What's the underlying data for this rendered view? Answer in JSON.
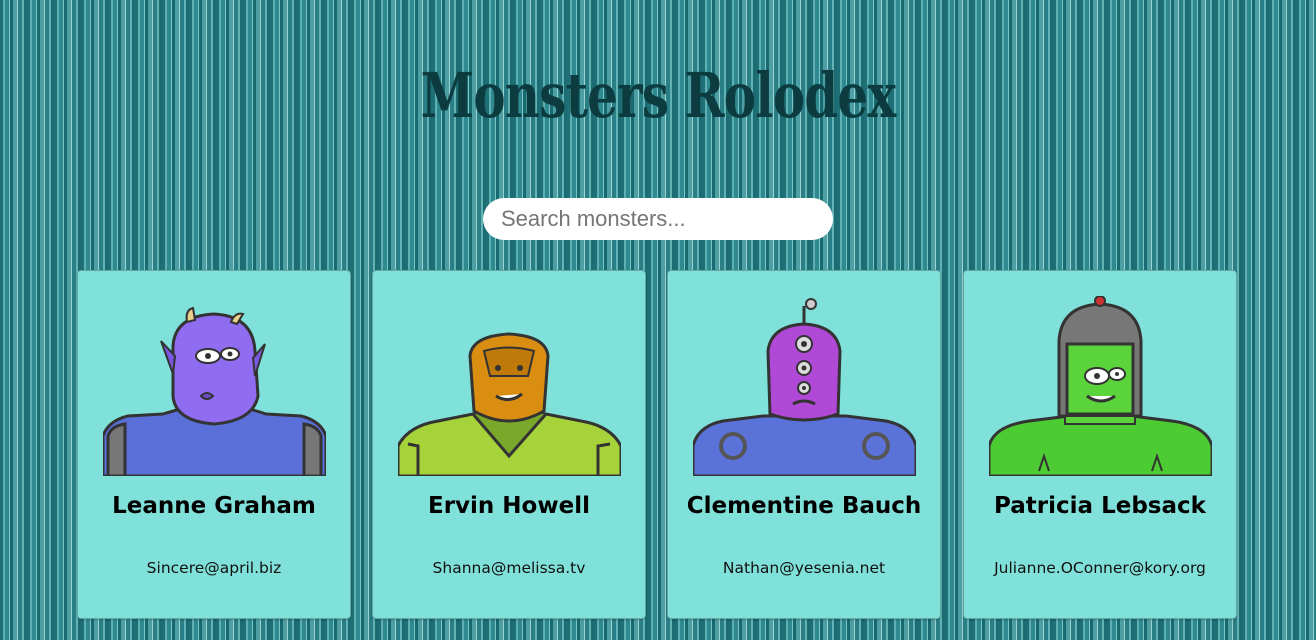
{
  "app": {
    "title": "Monsters Rolodex"
  },
  "search": {
    "placeholder": "Search monsters...",
    "value": ""
  },
  "monsters": [
    {
      "name": "Leanne Graham",
      "email": "Sincere@april.biz",
      "avatar_icon": "purple-horned-monster-avatar",
      "skin_color": "#8f6cf0",
      "body_color": "#5a6fd8"
    },
    {
      "name": "Ervin Howell",
      "email": "Shanna@melissa.tv",
      "avatar_icon": "orange-helmet-monster-avatar",
      "skin_color": "#d98e12",
      "body_color": "#a7d33a"
    },
    {
      "name": "Clementine Bauch",
      "email": "Nathan@yesenia.net",
      "avatar_icon": "three-eyed-purple-robot-monster-avatar",
      "skin_color": "#b04ad6",
      "body_color": "#5b72d9"
    },
    {
      "name": "Patricia Lebsack",
      "email": "Julianne.OConner@kory.org",
      "avatar_icon": "green-helmet-monster-avatar",
      "skin_color": "#5ad43a",
      "body_color": "#4ccc32"
    }
  ],
  "colors": {
    "card_background": "#80e1da",
    "title_color": "#0c3c40",
    "background_teal": "#2e8a90"
  }
}
